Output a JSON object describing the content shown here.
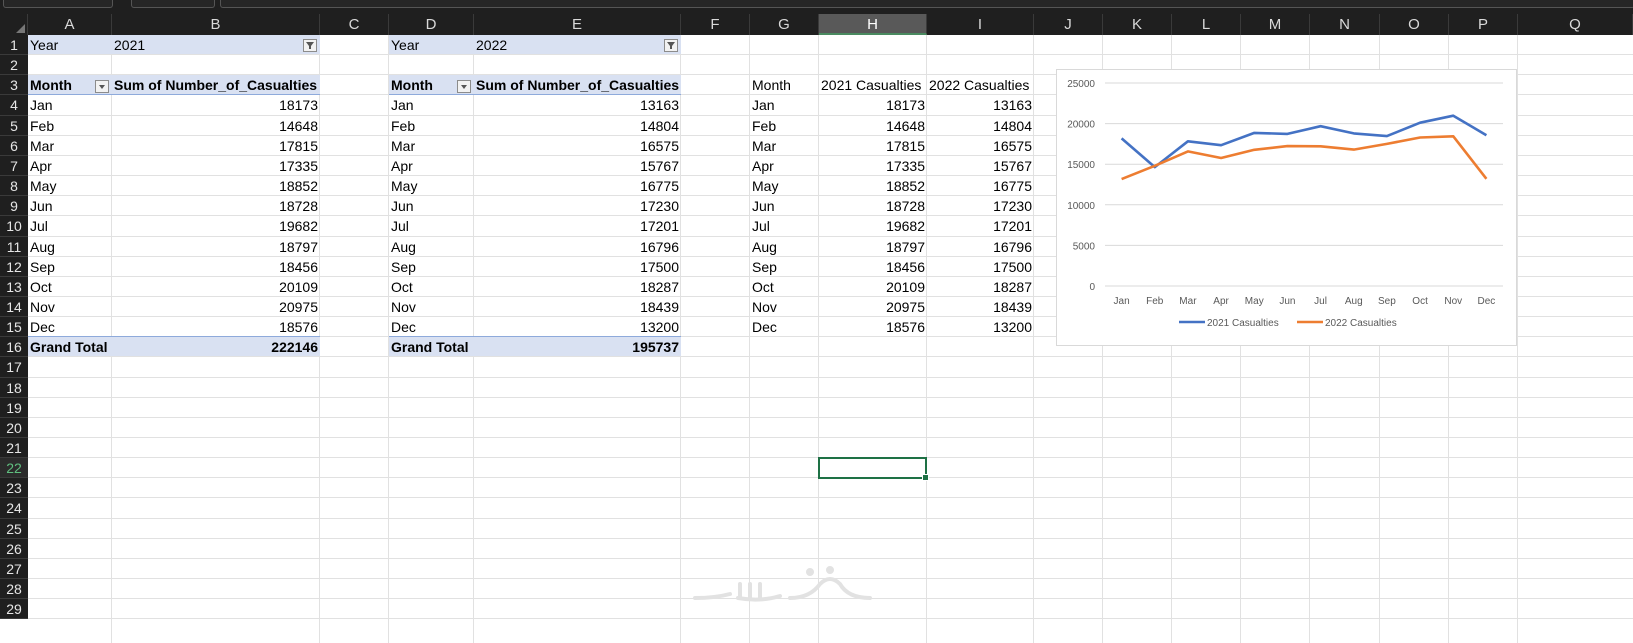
{
  "columns": [
    "A",
    "B",
    "C",
    "D",
    "E",
    "F",
    "G",
    "H",
    "I",
    "J",
    "K",
    "L",
    "M",
    "N",
    "O",
    "P",
    "Q"
  ],
  "selected_column": "H",
  "rows": [
    "1",
    "2",
    "3",
    "4",
    "5",
    "6",
    "7",
    "8",
    "9",
    "10",
    "11",
    "12",
    "13",
    "14",
    "15",
    "16",
    "17",
    "18",
    "19",
    "20",
    "21",
    "22",
    "23",
    "24",
    "25",
    "26",
    "27",
    "28",
    "29"
  ],
  "selected_row": "22",
  "pivot1": {
    "filter_label": "Year",
    "filter_value": "2021",
    "row_header": "Month",
    "value_header": "Sum of Number_of_Casualties",
    "rows": [
      {
        "month": "Jan",
        "value": "18173"
      },
      {
        "month": "Feb",
        "value": "14648"
      },
      {
        "month": "Mar",
        "value": "17815"
      },
      {
        "month": "Apr",
        "value": "17335"
      },
      {
        "month": "May",
        "value": "18852"
      },
      {
        "month": "Jun",
        "value": "18728"
      },
      {
        "month": "Jul",
        "value": "19682"
      },
      {
        "month": "Aug",
        "value": "18797"
      },
      {
        "month": "Sep",
        "value": "18456"
      },
      {
        "month": "Oct",
        "value": "20109"
      },
      {
        "month": "Nov",
        "value": "20975"
      },
      {
        "month": "Dec",
        "value": "18576"
      }
    ],
    "total_label": "Grand Total",
    "total_value": "222146"
  },
  "pivot2": {
    "filter_label": "Year",
    "filter_value": "2022",
    "row_header": "Month",
    "value_header": "Sum of Number_of_Casualties",
    "rows": [
      {
        "month": "Jan",
        "value": "13163"
      },
      {
        "month": "Feb",
        "value": "14804"
      },
      {
        "month": "Mar",
        "value": "16575"
      },
      {
        "month": "Apr",
        "value": "15767"
      },
      {
        "month": "May",
        "value": "16775"
      },
      {
        "month": "Jun",
        "value": "17230"
      },
      {
        "month": "Jul",
        "value": "17201"
      },
      {
        "month": "Aug",
        "value": "16796"
      },
      {
        "month": "Sep",
        "value": "17500"
      },
      {
        "month": "Oct",
        "value": "18287"
      },
      {
        "month": "Nov",
        "value": "18439"
      },
      {
        "month": "Dec",
        "value": "13200"
      }
    ],
    "total_label": "Grand Total",
    "total_value": "195737"
  },
  "summary_table": {
    "headers": [
      "Month",
      "2021 Casualties",
      "2022 Casualties"
    ],
    "rows": [
      [
        "Jan",
        "18173",
        "13163"
      ],
      [
        "Feb",
        "14648",
        "14804"
      ],
      [
        "Mar",
        "17815",
        "16575"
      ],
      [
        "Apr",
        "17335",
        "15767"
      ],
      [
        "May",
        "18852",
        "16775"
      ],
      [
        "Jun",
        "18728",
        "17230"
      ],
      [
        "Jul",
        "19682",
        "17201"
      ],
      [
        "Aug",
        "18797",
        "16796"
      ],
      [
        "Sep",
        "18456",
        "17500"
      ],
      [
        "Oct",
        "20109",
        "18287"
      ],
      [
        "Nov",
        "20975",
        "18439"
      ],
      [
        "Dec",
        "18576",
        "13200"
      ]
    ]
  },
  "chart_data": {
    "type": "line",
    "categories": [
      "Jan",
      "Feb",
      "Mar",
      "Apr",
      "May",
      "Jun",
      "Jul",
      "Aug",
      "Sep",
      "Oct",
      "Nov",
      "Dec"
    ],
    "series": [
      {
        "name": "2021 Casualties",
        "color": "#4472c4",
        "values": [
          18173,
          14648,
          17815,
          17335,
          18852,
          18728,
          19682,
          18797,
          18456,
          20109,
          20975,
          18576
        ]
      },
      {
        "name": "2022 Casualties",
        "color": "#ed7d31",
        "values": [
          13163,
          14804,
          16575,
          15767,
          16775,
          17230,
          17201,
          16796,
          17500,
          18287,
          18439,
          13200
        ]
      }
    ],
    "yticks": [
      "0",
      "5000",
      "10000",
      "15000",
      "20000",
      "25000"
    ],
    "ylim": [
      0,
      25000
    ],
    "grid": true,
    "legend": "bottom"
  },
  "watermark_text": "خمسات",
  "colors": {
    "pivot_band": "#d9e1f2",
    "accent_green": "#1e7145"
  }
}
